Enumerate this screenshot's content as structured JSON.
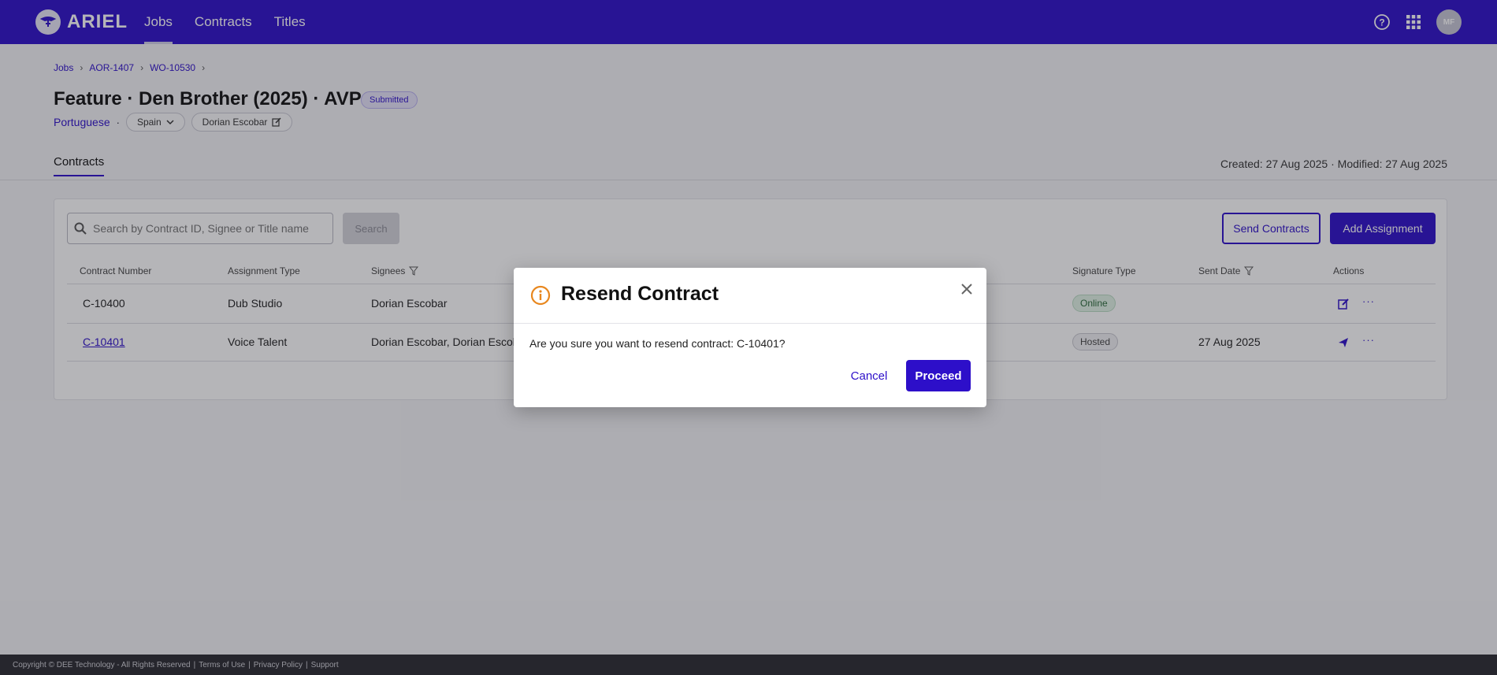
{
  "app": {
    "logo_text": "ARIEL",
    "nav": [
      "Jobs",
      "Contracts",
      "Titles"
    ],
    "avatar_initials": "MF",
    "accent": "#2d0fc9"
  },
  "breadcrumb": [
    "Jobs",
    "AOR-1407",
    "WO-10530"
  ],
  "page": {
    "title": "Feature · Den Brother (2025) · AVP",
    "status": "Submitted",
    "language": "Portuguese",
    "region": "Spain",
    "assignee": "Dorian Escobar",
    "tab": "Contracts",
    "created_modified": "Created: 27 Aug 2025 · Modified: 27 Aug 2025"
  },
  "toolbar": {
    "search_placeholder": "Search by Contract ID, Signee or Title name",
    "search_label": "Search",
    "send_label": "Send Contracts",
    "add_label": "Add Assignment"
  },
  "table": {
    "headers": [
      "Contract Number",
      "Assignment Type",
      "Signees",
      "Signature Type",
      "Sent Date",
      "Actions"
    ],
    "rows": [
      {
        "contract": "C-10400",
        "type": "Dub Studio",
        "signees": "Dorian Escobar",
        "signature": "Online",
        "sent": ""
      },
      {
        "contract": "C-10401",
        "type": "Voice Talent",
        "signees": "Dorian Escobar, Dorian Escoba",
        "signature": "Hosted",
        "sent": "27 Aug 2025"
      }
    ]
  },
  "modal": {
    "title": "Resend Contract",
    "message": "Are you sure you want to resend contract: C-10401?",
    "cancel_label": "Cancel",
    "proceed_label": "Proceed"
  },
  "footer": {
    "copyright": "Copyright © DEE Technology - All Rights Reserved",
    "links": [
      "Terms of Use",
      "Privacy Policy",
      "Support"
    ]
  }
}
